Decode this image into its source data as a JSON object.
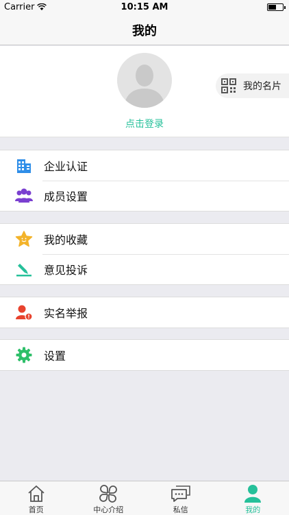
{
  "status_bar": {
    "carrier": "Carrier",
    "time": "10:15 AM"
  },
  "nav": {
    "title": "我的"
  },
  "profile": {
    "login_text": "点击登录",
    "card_button": "我的名片"
  },
  "menu_groups": [
    [
      {
        "label": "企业认证",
        "icon": "building-icon"
      },
      {
        "label": "成员设置",
        "icon": "members-icon"
      }
    ],
    [
      {
        "label": "我的收藏",
        "icon": "star-icon"
      },
      {
        "label": "意见投诉",
        "icon": "pen-icon"
      }
    ],
    [
      {
        "label": "实名举报",
        "icon": "report-user-icon"
      }
    ],
    [
      {
        "label": "设置",
        "icon": "gear-icon"
      }
    ]
  ],
  "tabs": [
    {
      "label": "首页",
      "icon": "home-icon"
    },
    {
      "label": "中心介绍",
      "icon": "clover-icon"
    },
    {
      "label": "私信",
      "icon": "chat-icon"
    },
    {
      "label": "我的",
      "icon": "person-icon",
      "active": true
    }
  ],
  "colors": {
    "accent": "#26c09a"
  }
}
